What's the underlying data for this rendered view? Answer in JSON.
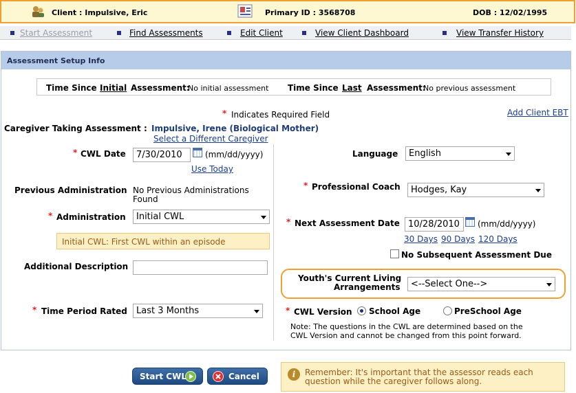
{
  "client_bar": {
    "client_label": "Client : Impulsive, Eric",
    "primary_id": "Primary ID : 3568708",
    "dob": "DOB : 12/02/1995"
  },
  "nav": {
    "items": [
      "Start Assessment",
      "Find Assessments",
      "Edit Client",
      "View Client Dashboard",
      "View Transfer History"
    ]
  },
  "panel": {
    "title": "Assessment Setup Info",
    "since_initial_pre": "Time Since",
    "since_initial_word": "Initial",
    "since_initial_post": "Assessment:",
    "since_initial_value": "No initial assessment",
    "since_last_pre": "Time Since",
    "since_last_word": "Last",
    "since_last_post": "Assessment:",
    "since_last_value": "No previous assessment",
    "required_note": "Indicates Required Field",
    "add_ebt": "Add Client EBT",
    "caregiver_label": "Caregiver Taking Assessment :",
    "caregiver_name": "Impulsive, Irene (Biological Mother)",
    "select_caregiver": "Select a Different Caregiver"
  },
  "left": {
    "cwl_date_label": "CWL Date",
    "cwl_date_value": "7/30/2010",
    "date_format": "(mm/dd/yyyy)",
    "use_today": "Use Today",
    "prev_admin_label": "Previous Administration",
    "prev_admin_value_1": "No Previous Administrations",
    "prev_admin_value_2": "Found",
    "administration_label": "Administration",
    "administration_value": "Initial CWL",
    "info_text": "Initial CWL: First CWL within an episode",
    "additional_desc_label": "Additional Description",
    "additional_desc_value": "",
    "time_period_label": "Time Period Rated",
    "time_period_value": "Last 3 Months"
  },
  "right": {
    "language_label": "Language",
    "language_value": "English",
    "coach_label": "Professional Coach",
    "coach_value": "Hodges, Kay",
    "next_date_label": "Next Assessment Date",
    "next_date_value": "10/28/2010",
    "date_format": "(mm/dd/yyyy)",
    "days_30": "30 Days",
    "days_90": "90 Days",
    "days_120": "120 Days",
    "no_subsequent": "No Subsequent Assessment Due",
    "living_label_1": "Youth's Current Living",
    "living_label_2": "Arrangements",
    "living_value": "<--Select One-->",
    "cwl_version_label": "CWL Version",
    "version_school": "School Age",
    "version_preschool": "PreSchool Age",
    "note_1": "Note: The questions in the CWL are determined based on the",
    "note_2": "CWL Version and cannot be changed from this point forward."
  },
  "actions": {
    "start_label": "Start CWL",
    "cancel_label": "Cancel",
    "remember_1": "Remember: It's important that the assessor reads each",
    "remember_2": "question while the caregiver follows along."
  },
  "required_mark": "*",
  "colors": {
    "header_border": "#f0a030",
    "header_bg": "#fdf8d2",
    "panel_header": "#b7cce9",
    "link": "#1a3d8f",
    "required": "#e02020"
  }
}
